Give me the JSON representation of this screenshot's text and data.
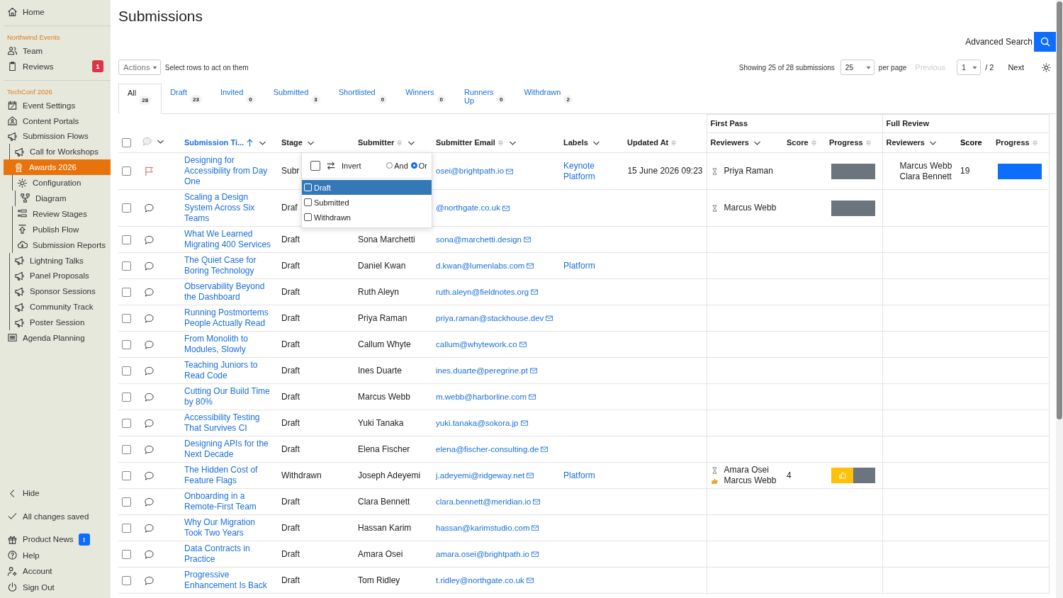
{
  "sidebar": {
    "groups": [
      {
        "items": [
          {
            "label": "Home",
            "kind": "home",
            "selected": false
          }
        ]
      },
      {
        "title": "Northwind Events",
        "items": [
          {
            "label": "Team",
            "kind": "team",
            "selected": false
          },
          {
            "label": "Reviews",
            "kind": "clipboard",
            "selected": false,
            "badge": {
              "text": "1",
              "color": "#dc3545"
            }
          }
        ]
      },
      {
        "title": "TechConf 2026",
        "items": [
          {
            "label": "Event Settings",
            "kind": "calendar",
            "selected": false
          },
          {
            "label": "Content Portals",
            "kind": "portal",
            "selected": false
          },
          {
            "label": "Submission Flows",
            "kind": "megaphone",
            "selected": false,
            "children": [
              {
                "label": "Call for Workshops",
                "kind": "megaphone",
                "selected": false
              },
              {
                "label": "Awards 2026",
                "kind": "award",
                "selected": true,
                "children": [
                  {
                    "label": "Configuration",
                    "kind": "gear",
                    "selected": false,
                    "children": [
                      {
                        "label": "Diagram",
                        "kind": "diagram",
                        "selected": false
                      }
                    ]
                  },
                  {
                    "label": "Review Stages",
                    "kind": "stages",
                    "selected": false
                  },
                  {
                    "label": "Publish Flow",
                    "kind": "publish",
                    "selected": false
                  },
                  {
                    "label": "Submission Reports",
                    "kind": "report",
                    "selected": false
                  }
                ]
              },
              {
                "label": "Lightning Talks",
                "kind": "megaphone",
                "selected": false
              },
              {
                "label": "Panel Proposals",
                "kind": "megaphone",
                "selected": false
              },
              {
                "label": "Sponsor Sessions",
                "kind": "megaphone",
                "selected": false
              },
              {
                "label": "Community Track",
                "kind": "megaphone",
                "selected": false
              },
              {
                "label": "Poster Session",
                "kind": "megaphone",
                "selected": false
              }
            ]
          },
          {
            "label": "Agenda Planning",
            "kind": "list",
            "selected": false
          }
        ]
      }
    ],
    "footer": [
      {
        "label": "Hide",
        "kind": "collapse"
      },
      {
        "label": "All changes saved",
        "kind": "saved"
      },
      {
        "label": "Product News",
        "kind": "gift",
        "badge": {
          "text": "!",
          "color": "#0d6efd"
        }
      },
      {
        "label": "Help",
        "kind": "help"
      },
      {
        "label": "Account",
        "kind": "account"
      },
      {
        "label": "Sign Out",
        "kind": "power"
      }
    ]
  },
  "page_title": "Submissions",
  "advanced_search": {
    "label": "Advanced Search"
  },
  "toolbar": {
    "actions": "Actions",
    "hint": "Select rows to act on them",
    "showing": "Showing 25 of 28 submissions",
    "per_page_value": "25",
    "per_page_label": "per page",
    "previous": {
      "label": "Previous",
      "disabled": true
    },
    "page_value": "1",
    "page_total": "/ 2",
    "next": {
      "label": "Next",
      "disabled": false
    }
  },
  "tabs": [
    {
      "label": "All",
      "count": "28",
      "selected": true
    },
    {
      "label": "Draft",
      "count": "23",
      "selected": false
    },
    {
      "label": "Invited",
      "count": "0",
      "selected": false
    },
    {
      "label": "Submitted",
      "count": "3",
      "selected": false
    },
    {
      "label": "Shortlisted",
      "count": "0",
      "selected": false
    },
    {
      "label": "Winners",
      "count": "0",
      "selected": false
    },
    {
      "label": "Runners Up",
      "count": "0",
      "selected": false
    },
    {
      "label": "Withdrawn",
      "count": "2",
      "selected": false
    }
  ],
  "table": {
    "groups": [
      {
        "label": "First Pass"
      },
      {
        "label": "Full Review"
      }
    ],
    "columns": [
      {
        "kind": "select",
        "checked": false
      },
      {
        "kind": "comments",
        "filter": true
      },
      {
        "kind": "text",
        "label": "Submission Ti...",
        "sortable": true,
        "sorted": true,
        "filter": true,
        "bold": false
      },
      {
        "kind": "text",
        "label": "Stage",
        "sortable": false,
        "sorted": false,
        "filter": true,
        "bold": false
      },
      {
        "kind": "text",
        "label": "Submitter",
        "sortable": true,
        "sorted": false,
        "filter": true,
        "bold": false
      },
      {
        "kind": "text",
        "label": "Submitter Email",
        "sortable": true,
        "sorted": false,
        "filter": true,
        "bold": false
      },
      {
        "kind": "text",
        "label": "Labels",
        "sortable": false,
        "sorted": false,
        "filter": true,
        "bold": false
      },
      {
        "kind": "text",
        "label": "Updated At",
        "sortable": true,
        "sorted": false,
        "filter": false,
        "bold": false
      },
      {
        "kind": "text",
        "label": "Reviewers",
        "sortable": false,
        "sorted": false,
        "filter": true,
        "bold": false
      },
      {
        "kind": "text",
        "label": "Score",
        "sortable": true,
        "sorted": false,
        "filter": false,
        "bold": false
      },
      {
        "kind": "text",
        "label": "Progress",
        "sortable": true,
        "sorted": false,
        "filter": false,
        "bold": false
      },
      {
        "kind": "text",
        "label": "Reviewers",
        "sortable": false,
        "sorted": false,
        "filter": true,
        "bold": false
      },
      {
        "kind": "text",
        "label": "Score",
        "sortable": false,
        "sorted": false,
        "filter": false,
        "bold": true
      },
      {
        "kind": "text",
        "label": "Progress",
        "sortable": true,
        "sorted": false,
        "filter": false,
        "bold": false
      }
    ],
    "rows": [
      {
        "checked": false,
        "flagged": true,
        "title": "Designing for Accessibility from Day One",
        "stage": "Subr",
        "email": "osei@brightpath.io",
        "labels": [
          "Keynote",
          "Platform"
        ],
        "updated": "15 June 2026 09:23",
        "first_pass": {
          "reviewers": [
            {
              "name": "Priya Raman",
              "kind": "pending"
            }
          ],
          "progress": {
            "level": 0
          }
        },
        "full_review": {
          "reviewers": [
            {
              "name": "Marcus Webb"
            },
            {
              "name": "Clara Bennett"
            }
          ],
          "score": "19",
          "progress": {
            "level": 1
          }
        }
      },
      {
        "checked": false,
        "flagged": false,
        "title": "Scaling a Design System Across Six Teams",
        "stage": "Draf",
        "email": "@northgate.co.uk",
        "first_pass": {
          "reviewers": [
            {
              "name": "Marcus Webb",
              "kind": "pending"
            }
          ],
          "progress": {
            "level": 0
          }
        }
      },
      {
        "checked": false,
        "flagged": false,
        "title": "What We Learned Migrating 400 Services",
        "stage": "Draft",
        "submitter": "Sona Marchetti",
        "email": "sona@marchetti.design"
      },
      {
        "checked": false,
        "flagged": false,
        "title": "The Quiet Case for Boring Technology",
        "stage": "Draft",
        "submitter": "Daniel Kwan",
        "email": "d.kwan@lumenlabs.com",
        "labels": [
          "Platform"
        ]
      },
      {
        "checked": false,
        "flagged": false,
        "title": "Observability Beyond the Dashboard",
        "stage": "Draft",
        "submitter": "Ruth Aleyn",
        "email": "ruth.aleyn@fieldnotes.org"
      },
      {
        "checked": false,
        "flagged": false,
        "title": "Running Postmortems People Actually Read",
        "stage": "Draft",
        "submitter": "Priya Raman",
        "email": "priya.raman@stackhouse.dev"
      },
      {
        "checked": false,
        "flagged": false,
        "title": "From Monolith to Modules, Slowly",
        "stage": "Draft",
        "submitter": "Callum Whyte",
        "email": "callum@whytework.co"
      },
      {
        "checked": false,
        "flagged": false,
        "title": "Teaching Juniors to Read Code",
        "stage": "Draft",
        "submitter": "Ines Duarte",
        "email": "ines.duarte@peregrine.pt"
      },
      {
        "checked": false,
        "flagged": false,
        "title": "Cutting Our Build Time by 80%",
        "stage": "Draft",
        "submitter": "Marcus Webb",
        "email": "m.webb@harborline.com"
      },
      {
        "checked": false,
        "flagged": false,
        "title": "Accessibility Testing That Survives CI",
        "stage": "Draft",
        "submitter": "Yuki Tanaka",
        "email": "yuki.tanaka@sokora.jp"
      },
      {
        "checked": false,
        "flagged": false,
        "title": "Designing APIs for the Next Decade",
        "stage": "Draft",
        "submitter": "Elena Fischer",
        "email": "elena@fischer-consulting.de"
      },
      {
        "checked": false,
        "flagged": false,
        "title": "The Hidden Cost of Feature Flags",
        "stage": "Withdrawn",
        "submitter": "Joseph Adeyemi",
        "email": "j.adeyemi@ridgeway.net",
        "labels": [
          "Platform"
        ],
        "first_pass": {
          "reviewers": [
            {
              "name": "Amara Osei",
              "kind": "pending"
            },
            {
              "name": "Marcus Webb",
              "kind": "liked"
            }
          ],
          "score": "4",
          "progress": {
            "level": 0.5,
            "kind": "liked"
          }
        }
      },
      {
        "checked": false,
        "flagged": false,
        "title": "Onboarding in a Remote-First Team",
        "stage": "Draft",
        "submitter": "Clara Bennett",
        "email": "clara.bennett@meridian.io"
      },
      {
        "checked": false,
        "flagged": false,
        "title": "Why Our Migration Took Two Years",
        "stage": "Draft",
        "submitter": "Hassan Karim",
        "email": "hassan@karimstudio.com"
      },
      {
        "checked": false,
        "flagged": false,
        "title": "Data Contracts in Practice",
        "stage": "Draft",
        "submitter": "Amara Osei",
        "email": "amara.osei@brightpath.io"
      },
      {
        "checked": false,
        "flagged": false,
        "title": "Progressive Enhancement Is Back",
        "stage": "Draft",
        "submitter": "Tom Ridley",
        "email": "t.ridley@northgate.co.uk"
      }
    ]
  },
  "stage_filter": {
    "invert_label": "Invert",
    "invert_checked": false,
    "modes": [
      {
        "label": "And",
        "selected": false
      },
      {
        "label": "Or",
        "selected": true
      }
    ],
    "options": [
      {
        "label": "Draft",
        "checked": false,
        "highlighted": true
      },
      {
        "label": "Submitted",
        "checked": false,
        "highlighted": false
      },
      {
        "label": "Withdrawn",
        "checked": false,
        "highlighted": false
      }
    ]
  }
}
